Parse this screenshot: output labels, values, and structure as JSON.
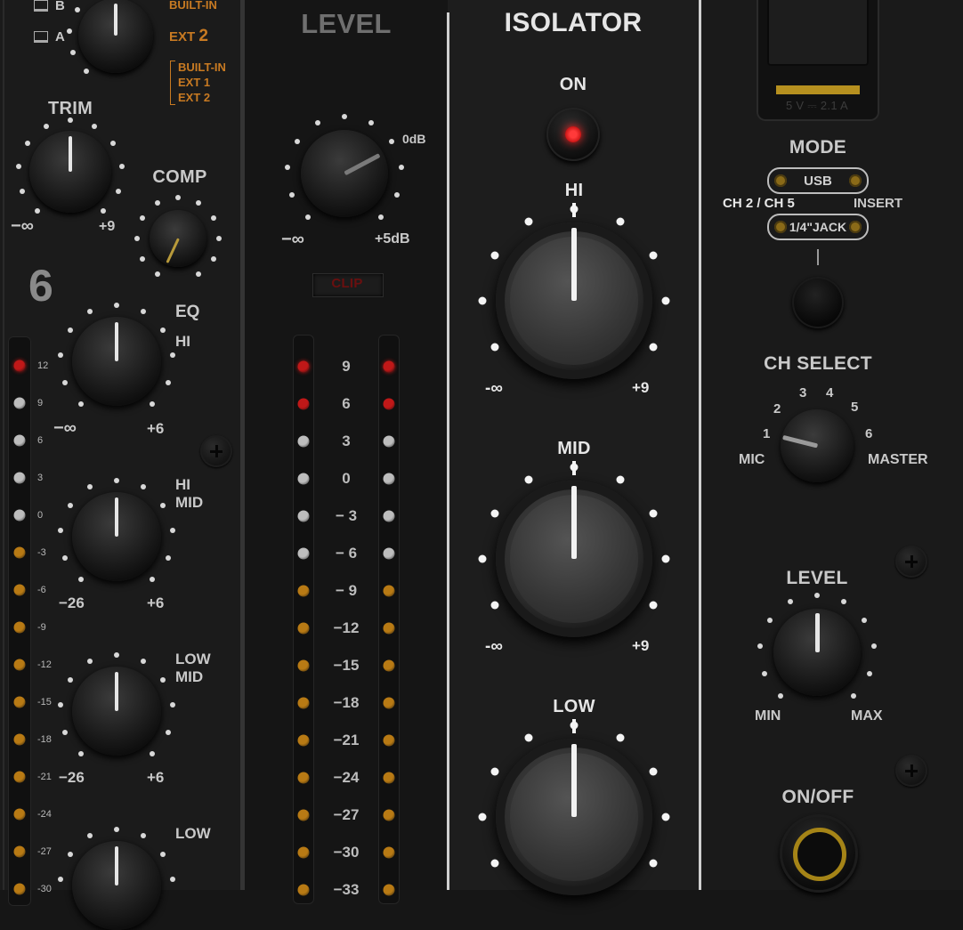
{
  "left_strip": {
    "input_labels": [
      "B",
      "A"
    ],
    "selector_options_top": [
      "BUILT-IN",
      "EXT 2"
    ],
    "ext_number": "2",
    "bracket_options": [
      "BUILT-IN",
      "EXT 1",
      "EXT 2"
    ],
    "trim": {
      "label": "TRIM",
      "min": "−∞",
      "max": "+9"
    },
    "comp": {
      "label": "COMP"
    },
    "channel_number": "6",
    "eq": {
      "label": "EQ",
      "hi": {
        "label": "HI",
        "min": "−∞",
        "max": "+6"
      },
      "hi_mid": {
        "label_top": "HI",
        "label_bottom": "MID",
        "min": "−26",
        "max": "+6"
      },
      "low_mid": {
        "label_top": "LOW",
        "label_bottom": "MID",
        "min": "−26",
        "max": "+6"
      },
      "low": {
        "label": "LOW"
      }
    },
    "meter_scale": [
      "12",
      "9",
      "6",
      "3",
      "0",
      "-3",
      "-6",
      "-9",
      "-12",
      "-15",
      "-18",
      "-21",
      "-24",
      "-27",
      "-30"
    ]
  },
  "level_section": {
    "title": "LEVEL",
    "zero_db": "0dB",
    "min": "−∞",
    "max": "+5dB",
    "clip": "CLIP",
    "scale": [
      "9",
      "6",
      "3",
      "0",
      "− 3",
      "− 6",
      "− 9",
      "−12",
      "−15",
      "−18",
      "−21",
      "−24",
      "−27",
      "−30",
      "−33"
    ]
  },
  "isolator": {
    "title": "ISOLATOR",
    "on_label": "ON",
    "hi": {
      "label": "HI",
      "min": "-∞",
      "max": "+9"
    },
    "mid": {
      "label": "MID",
      "min": "-∞",
      "max": "+9"
    },
    "low": {
      "label": "LOW"
    }
  },
  "right_section": {
    "usb_rating": "5 V ⎓ 2.1 A",
    "mode": {
      "label": "MODE",
      "usb": "USB",
      "jack": "1/4\"JACK",
      "left_label": "CH 2 / CH 5",
      "right_label": "INSERT"
    },
    "ch_select": {
      "label": "CH SELECT",
      "numbers": [
        "1",
        "2",
        "3",
        "4",
        "5",
        "6"
      ],
      "mic": "MIC",
      "master": "MASTER"
    },
    "level": {
      "label": "LEVEL",
      "min": "MIN",
      "max": "MAX"
    },
    "on_off": {
      "label": "ON/OFF"
    }
  },
  "colors": {
    "led_red": "#c01818",
    "led_white": "#bdbdbd",
    "led_amber": "#b87a14",
    "amber_text": "#c87a22",
    "on_button_red": "#ff2020"
  }
}
